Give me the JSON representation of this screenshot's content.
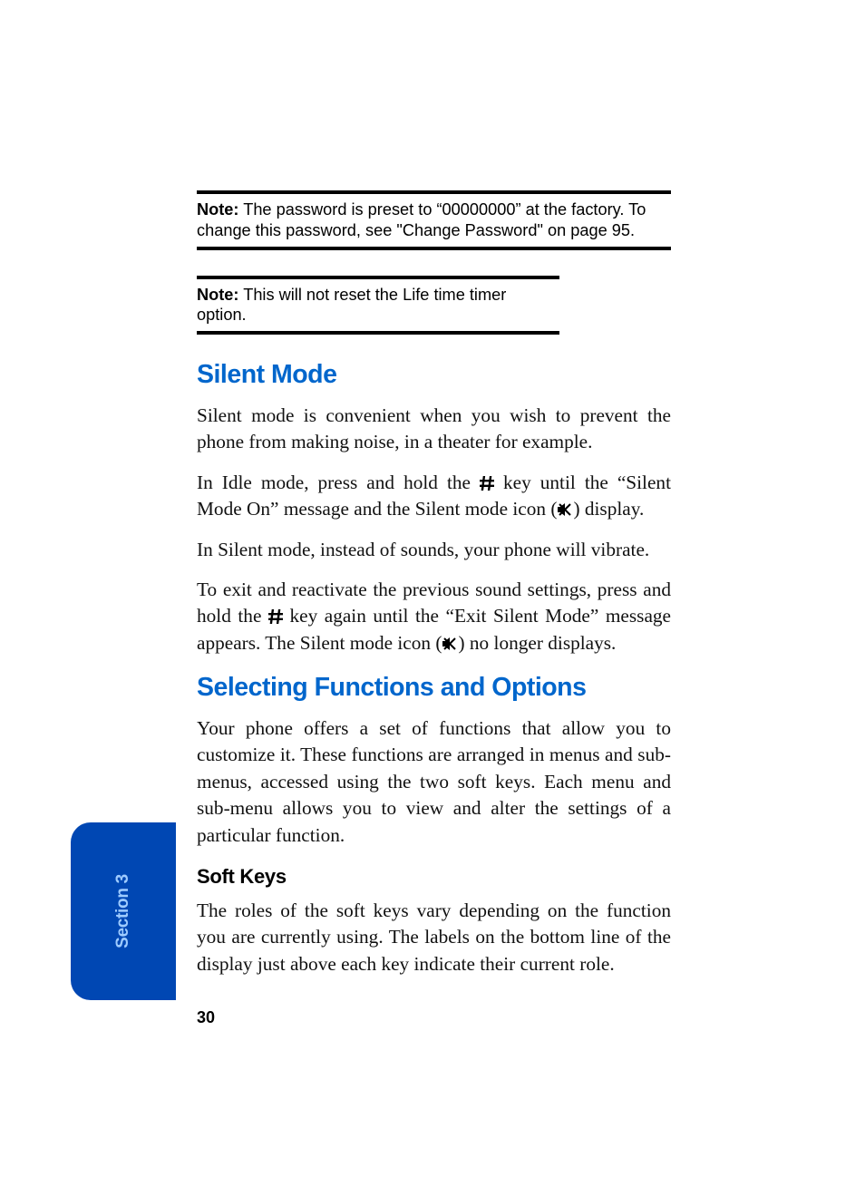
{
  "notes": {
    "label": "Note:",
    "n1_text": " The password is preset to “00000000” at the factory. To change this password, see \"Change Password\" on page 95.",
    "n2_text": " This will not reset the Life time timer option."
  },
  "silent": {
    "heading": "Silent Mode",
    "p1": "Silent mode is convenient when you wish to prevent the phone from making noise, in a theater for example.",
    "p2a": "In Idle mode, press and hold the ",
    "p2b": " key until the “Silent Mode On” message and the Silent mode icon (",
    "p2c": ") display.",
    "p3": "In Silent mode, instead of sounds, your phone will vibrate.",
    "p4a": "To exit and reactivate the previous sound settings, press and hold the ",
    "p4b": " key again until the “Exit Silent Mode” message appears. The Silent mode icon (",
    "p4c": ") no longer displays."
  },
  "selecting": {
    "heading": "Selecting Functions and Options",
    "p1": "Your phone offers a set of functions that allow you to customize it. These functions are arranged in menus and sub-menus, accessed using the two soft keys. Each menu and sub-menu allows you to view and alter the settings of a particular function.",
    "softkeys_heading": "Soft Keys",
    "p2": "The roles of the soft keys vary depending on the function you are currently using. The labels on the bottom line of the display just above each key indicate their current role."
  },
  "page_number": "30",
  "tab_label": "Section 3",
  "icons": {
    "pound": "pound-key-icon",
    "mute": "mute-speaker-icon"
  }
}
